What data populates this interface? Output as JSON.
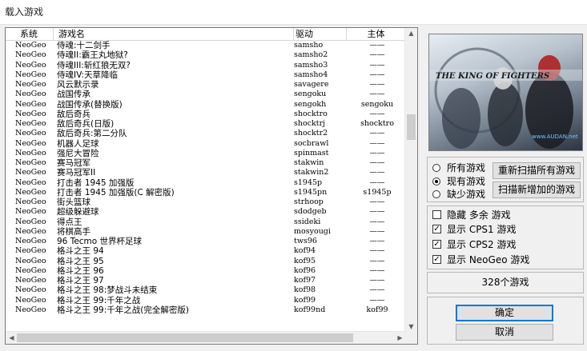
{
  "window": {
    "title": "载入游戏"
  },
  "list": {
    "columns": [
      "系统",
      "游戏名",
      "驱动",
      "主体"
    ],
    "rows": [
      [
        "NeoGeo",
        "侍魂:十二剑手",
        "samsho",
        "——"
      ],
      [
        "NeoGeo",
        "侍魂II:霸王丸地狱?",
        "samsho2",
        "——"
      ],
      [
        "NeoGeo",
        "侍魂III:斩红狼无双?",
        "samsho3",
        "——"
      ],
      [
        "NeoGeo",
        "侍魂IV:天草降临",
        "samsho4",
        "——"
      ],
      [
        "NeoGeo",
        "风云默示录",
        "savagere",
        "——"
      ],
      [
        "NeoGeo",
        "战国传承",
        "sengoku",
        "——"
      ],
      [
        "NeoGeo",
        "战国传承(替换版)",
        "sengokh",
        "sengoku"
      ],
      [
        "NeoGeo",
        "敌后奇兵",
        "shocktro",
        "——"
      ],
      [
        "NeoGeo",
        "敌后奇兵(日版)",
        "shocktrj",
        "shocktro"
      ],
      [
        "NeoGeo",
        "敌后奇兵:第二分队",
        "shocktr2",
        "——"
      ],
      [
        "NeoGeo",
        "机器人足球",
        "socbrawl",
        "——"
      ],
      [
        "NeoGeo",
        "强尼大冒险",
        "spinmast",
        "——"
      ],
      [
        "NeoGeo",
        "赛马冠军",
        "stakwin",
        "——"
      ],
      [
        "NeoGeo",
        "赛马冠军II",
        "stakwin2",
        "——"
      ],
      [
        "NeoGeo",
        "打击者 1945 加强版",
        "s1945p",
        "——"
      ],
      [
        "NeoGeo",
        "打击者 1945 加强版(C 解密版)",
        "s1945pn",
        "s1945p"
      ],
      [
        "NeoGeo",
        "街头篮球",
        "strhoop",
        "——"
      ],
      [
        "NeoGeo",
        "超级躲避球",
        "sdodgeb",
        "——"
      ],
      [
        "NeoGeo",
        "得点王",
        "ssideki",
        "——"
      ],
      [
        "NeoGeo",
        "将棋高手",
        "mosyougi",
        "——"
      ],
      [
        "NeoGeo",
        "96 Tecmo 世界杯足球",
        "tws96",
        "——"
      ],
      [
        "NeoGeo",
        "格斗之王 94",
        "kof94",
        "——"
      ],
      [
        "NeoGeo",
        "格斗之王 95",
        "kof95",
        "——"
      ],
      [
        "NeoGeo",
        "格斗之王 96",
        "kof96",
        "——"
      ],
      [
        "NeoGeo",
        "格斗之王 97",
        "kof97",
        "——"
      ],
      [
        "NeoGeo",
        "格斗之王 98:梦战斗未结束",
        "kof98",
        "——"
      ],
      [
        "NeoGeo",
        "格斗之王 99:千年之战",
        "kof99",
        "——"
      ],
      [
        "NeoGeo",
        "格斗之王 99:千年之战(完全解密版)",
        "kof99nd",
        "kof99"
      ]
    ]
  },
  "preview": {
    "title_text": "THE KING OF FIGHTERS",
    "watermark": "www.AUDAN.net"
  },
  "filter": {
    "options": [
      {
        "label": "所有游戏",
        "checked": false
      },
      {
        "label": "现有游戏",
        "checked": true
      },
      {
        "label": "缺少游戏",
        "checked": false
      }
    ],
    "rescan_all": "重新扫描所有游戏",
    "rescan_new": "扫描新增加的游戏"
  },
  "display": {
    "options": [
      {
        "label": "隐藏 多余 游戏",
        "checked": false
      },
      {
        "label": "显示 CPS1 游戏",
        "checked": true
      },
      {
        "label": "显示 CPS2 游戏",
        "checked": true
      },
      {
        "label": "显示 NeoGeo 游戏",
        "checked": true
      }
    ]
  },
  "count": "328个游戏",
  "buttons": {
    "ok": "确定",
    "cancel": "取消"
  }
}
